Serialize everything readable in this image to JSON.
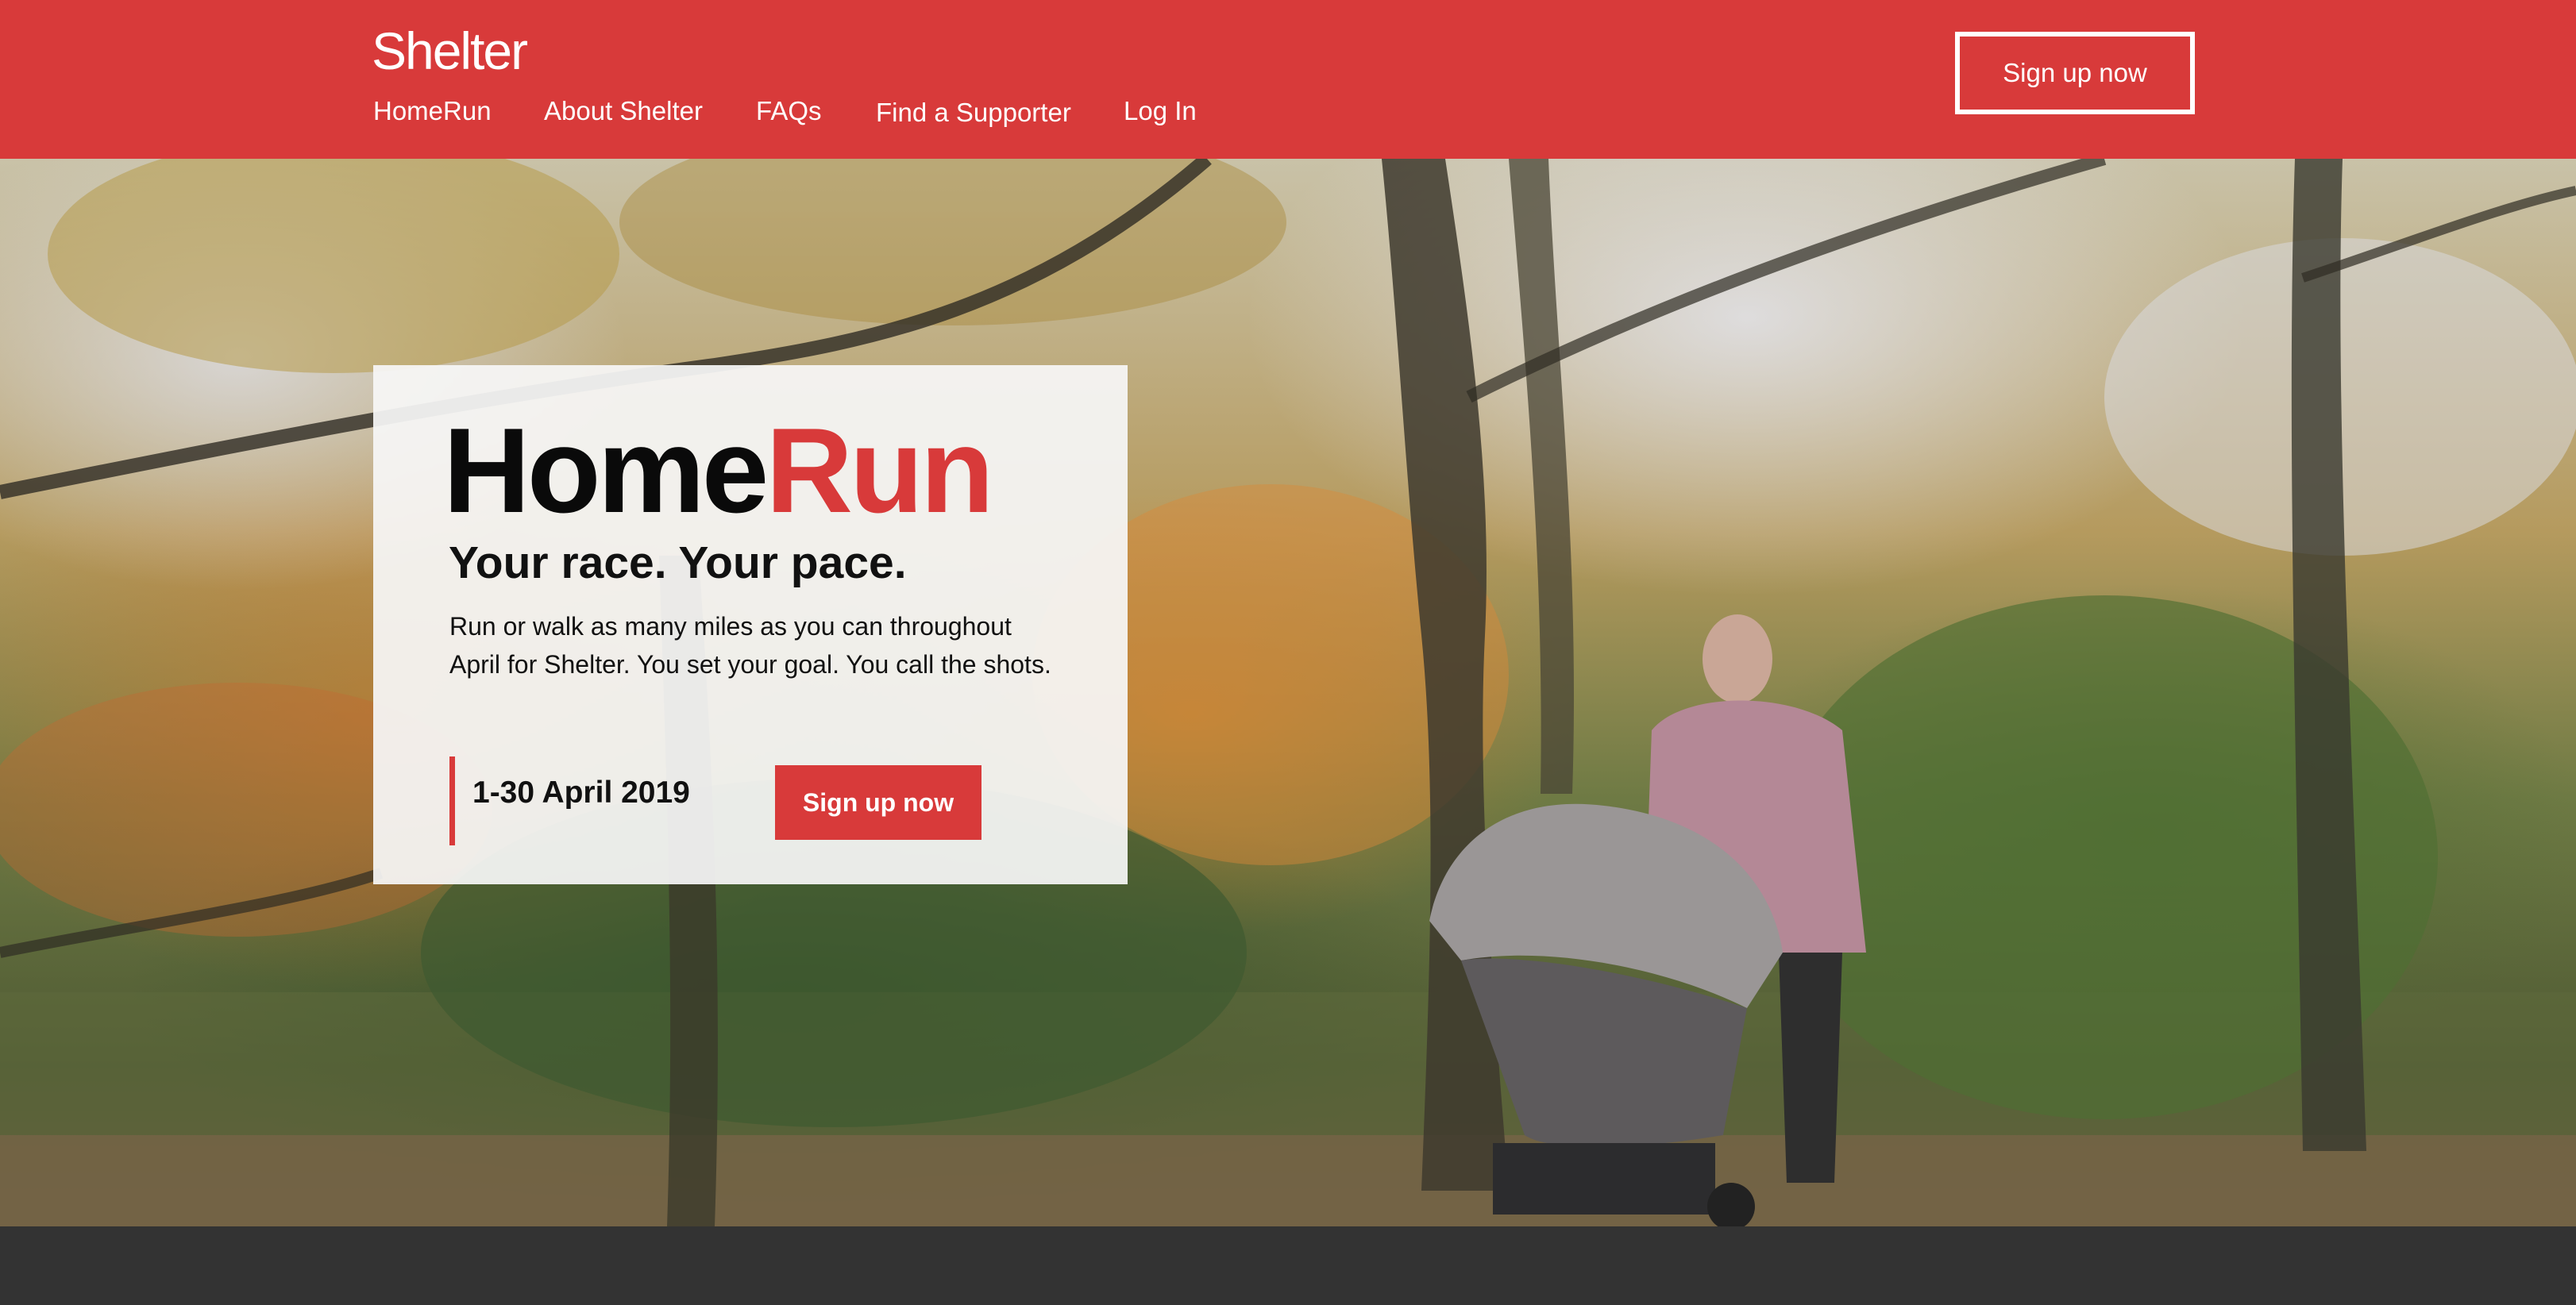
{
  "header": {
    "logo": "Shelter",
    "nav": [
      {
        "label": "HomeRun"
      },
      {
        "label": "About Shelter"
      },
      {
        "label": "FAQs"
      },
      {
        "label": "Find a Supporter"
      },
      {
        "label": "Log In"
      }
    ],
    "cta_label": "Sign up now"
  },
  "hero": {
    "title_part1": "Home",
    "title_part2": "Run",
    "subtitle": "Your race. Your pace.",
    "body": "Run or walk as many miles as you can throughout April for Shelter. You set your goal. You call the shots.",
    "date": "1-30 April 2019",
    "cta_label": "Sign up now"
  },
  "colors": {
    "brand_red": "#d83a3a",
    "footer_dark": "#333333"
  }
}
